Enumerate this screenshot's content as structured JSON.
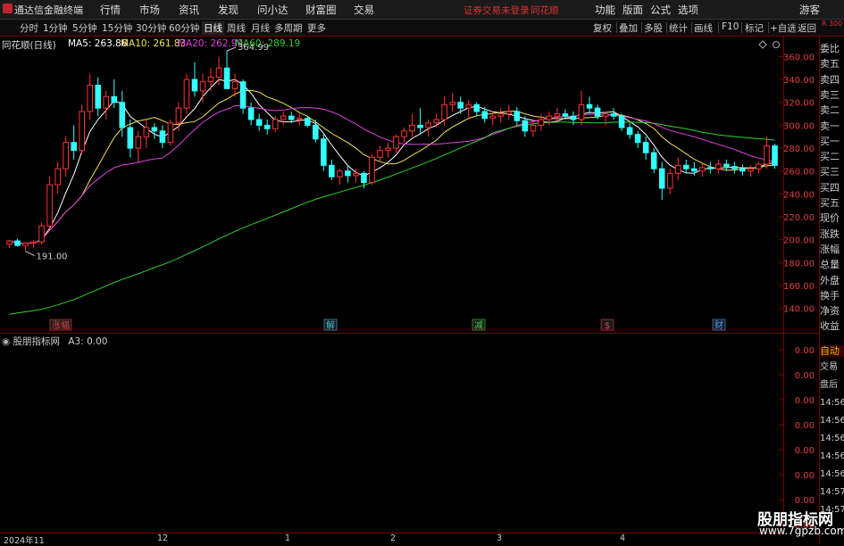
{
  "menubar": {
    "app_name": "通达信金融终端",
    "items": [
      "行情",
      "市场",
      "资讯",
      "发现",
      "问小达",
      "财富圈",
      "交易"
    ],
    "login_status": "证券交易未登录",
    "ths_link": "同花顺",
    "right_items": [
      "功能",
      "版面",
      "公式",
      "选项"
    ],
    "guest": "游客"
  },
  "toolbar": {
    "periods": [
      "分时",
      "1分钟",
      "5分钟",
      "15分钟",
      "30分钟",
      "60分钟",
      "日线",
      "周线",
      "月线",
      "多周期",
      "更多"
    ],
    "active_period": "日线",
    "right_buttons": [
      "复权",
      "叠加",
      "多股",
      "统计",
      "画线",
      "F10",
      "标记",
      "+自选",
      "返回"
    ]
  },
  "chart": {
    "title": "同花顺(日线)",
    "ma": [
      {
        "label": "MA5: 263.86",
        "color": "#ffffff"
      },
      {
        "label": "MA10: 261.83",
        "color": "#f0e050"
      },
      {
        "label": "MA20: 262.99",
        "color": "#e040e0"
      },
      {
        "label": "MA60: 289.19",
        "color": "#30d030"
      }
    ],
    "y_ticks": [
      "360.00",
      "340.00",
      "320.00",
      "300.00",
      "280.00",
      "260.00",
      "240.00",
      "220.00",
      "200.00",
      "180.00",
      "160.00",
      "140.00"
    ],
    "y_values": [
      360,
      340,
      320,
      300,
      280,
      260,
      240,
      220,
      200,
      180,
      160,
      140
    ],
    "high_label": "364.99",
    "low_label": "191.00",
    "event_tags": [
      {
        "text": "涨幅",
        "color": "#e04040"
      },
      {
        "text": "解",
        "color": "#40c0e0"
      },
      {
        "text": "减",
        "color": "#40d040"
      },
      {
        "text": "$",
        "color": "#e04040"
      },
      {
        "text": "财",
        "color": "#40a0ff"
      }
    ]
  },
  "chart_data": {
    "type": "candlestick",
    "ylim": [
      125,
      372
    ],
    "colors": {
      "up": "#ff3333",
      "down": "#33ffff",
      "ma5": "#ffffff",
      "ma10": "#f0e050",
      "ma20": "#e040e0",
      "ma60": "#30d030"
    },
    "ohlc": [
      [
        196,
        200,
        193,
        199
      ],
      [
        199,
        201,
        194,
        195
      ],
      [
        195,
        198,
        190,
        197
      ],
      [
        197,
        200,
        193,
        198
      ],
      [
        198,
        215,
        196,
        212
      ],
      [
        212,
        255,
        210,
        248
      ],
      [
        248,
        268,
        240,
        262
      ],
      [
        262,
        290,
        255,
        285
      ],
      [
        285,
        300,
        270,
        278
      ],
      [
        278,
        318,
        275,
        312
      ],
      [
        312,
        345,
        305,
        335
      ],
      [
        335,
        342,
        308,
        315
      ],
      [
        315,
        330,
        305,
        325
      ],
      [
        325,
        340,
        315,
        320
      ],
      [
        320,
        330,
        290,
        298
      ],
      [
        298,
        305,
        272,
        280
      ],
      [
        280,
        295,
        268,
        290
      ],
      [
        290,
        305,
        280,
        298
      ],
      [
        298,
        302,
        288,
        295
      ],
      [
        295,
        300,
        280,
        285
      ],
      [
        285,
        305,
        282,
        302
      ],
      [
        302,
        320,
        295,
        315
      ],
      [
        315,
        345,
        310,
        340
      ],
      [
        340,
        355,
        325,
        330
      ],
      [
        330,
        345,
        320,
        338
      ],
      [
        338,
        350,
        330,
        342
      ],
      [
        342,
        360,
        335,
        350
      ],
      [
        350,
        365,
        340,
        332
      ],
      [
        332,
        345,
        325,
        338
      ],
      [
        338,
        340,
        310,
        315
      ],
      [
        315,
        320,
        300,
        305
      ],
      [
        305,
        310,
        295,
        300
      ],
      [
        300,
        305,
        292,
        297
      ],
      [
        297,
        308,
        294,
        305
      ],
      [
        305,
        312,
        300,
        308
      ],
      [
        308,
        312,
        302,
        305
      ],
      [
        305,
        310,
        300,
        306
      ],
      [
        306,
        308,
        298,
        300
      ],
      [
        300,
        305,
        285,
        288
      ],
      [
        288,
        292,
        260,
        265
      ],
      [
        265,
        270,
        252,
        255
      ],
      [
        255,
        262,
        248,
        260
      ],
      [
        260,
        265,
        250,
        256
      ],
      [
        256,
        262,
        250,
        258
      ],
      [
        258,
        260,
        245,
        250
      ],
      [
        250,
        275,
        248,
        272
      ],
      [
        272,
        282,
        268,
        278
      ],
      [
        278,
        285,
        272,
        280
      ],
      [
        280,
        292,
        276,
        290
      ],
      [
        290,
        298,
        285,
        295
      ],
      [
        295,
        310,
        290,
        300
      ],
      [
        300,
        315,
        292,
        298
      ],
      [
        298,
        305,
        290,
        302
      ],
      [
        302,
        310,
        298,
        305
      ],
      [
        305,
        325,
        300,
        318
      ],
      [
        318,
        328,
        312,
        320
      ],
      [
        320,
        325,
        310,
        315
      ],
      [
        315,
        322,
        305,
        318
      ],
      [
        318,
        320,
        308,
        312
      ],
      [
        312,
        316,
        302,
        306
      ],
      [
        306,
        312,
        300,
        308
      ],
      [
        308,
        315,
        302,
        310
      ],
      [
        310,
        318,
        305,
        312
      ],
      [
        312,
        316,
        300,
        304
      ],
      [
        304,
        308,
        290,
        295
      ],
      [
        295,
        305,
        290,
        300
      ],
      [
        300,
        310,
        295,
        305
      ],
      [
        305,
        312,
        300,
        308
      ],
      [
        308,
        315,
        302,
        310
      ],
      [
        310,
        314,
        305,
        308
      ],
      [
        308,
        312,
        300,
        305
      ],
      [
        305,
        330,
        300,
        318
      ],
      [
        318,
        325,
        310,
        315
      ],
      [
        315,
        318,
        305,
        308
      ],
      [
        308,
        312,
        300,
        310
      ],
      [
        310,
        315,
        305,
        308
      ],
      [
        308,
        310,
        295,
        298
      ],
      [
        298,
        302,
        288,
        292
      ],
      [
        292,
        295,
        280,
        285
      ],
      [
        285,
        290,
        270,
        276
      ],
      [
        276,
        280,
        258,
        262
      ],
      [
        262,
        268,
        235,
        245
      ],
      [
        245,
        262,
        240,
        258
      ],
      [
        258,
        272,
        252,
        265
      ],
      [
        265,
        270,
        258,
        262
      ],
      [
        262,
        268,
        256,
        260
      ],
      [
        260,
        266,
        255,
        263
      ],
      [
        263,
        268,
        258,
        262
      ],
      [
        262,
        270,
        258,
        266
      ],
      [
        266,
        270,
        260,
        264
      ],
      [
        264,
        268,
        258,
        262
      ],
      [
        262,
        266,
        256,
        260
      ],
      [
        260,
        265,
        255,
        262
      ],
      [
        262,
        268,
        258,
        266
      ],
      [
        266,
        290,
        262,
        282
      ],
      [
        282,
        284,
        262,
        265
      ]
    ]
  },
  "indicator": {
    "title": "股朋指标网",
    "value": "A3: 0.00",
    "y_ticks": [
      "0.00",
      "0.00",
      "0.00",
      "0.00",
      "0.00",
      "0.00",
      "0.00",
      "0.00"
    ]
  },
  "right_panel": {
    "ratio_label": "R 300",
    "rows": [
      "委比",
      "卖五",
      "卖四",
      "卖三",
      "卖二",
      "卖一",
      "买一",
      "买二",
      "买三",
      "买四",
      "买五",
      "现价",
      "涨跌",
      "涨幅",
      "总量",
      "外盘",
      "换手",
      "净资",
      "收益"
    ],
    "auto": "自动",
    "lower_rows": [
      "交易",
      "盘后",
      "14:56",
      "14:56",
      "14:56",
      "14:56",
      "14:56",
      "14:57",
      "14:57"
    ]
  },
  "dates": [
    "2024年11",
    "12",
    "1",
    "2",
    "3",
    "4"
  ],
  "watermark": {
    "title": "股朋指标网",
    "url": "www.7gpzb.com"
  }
}
